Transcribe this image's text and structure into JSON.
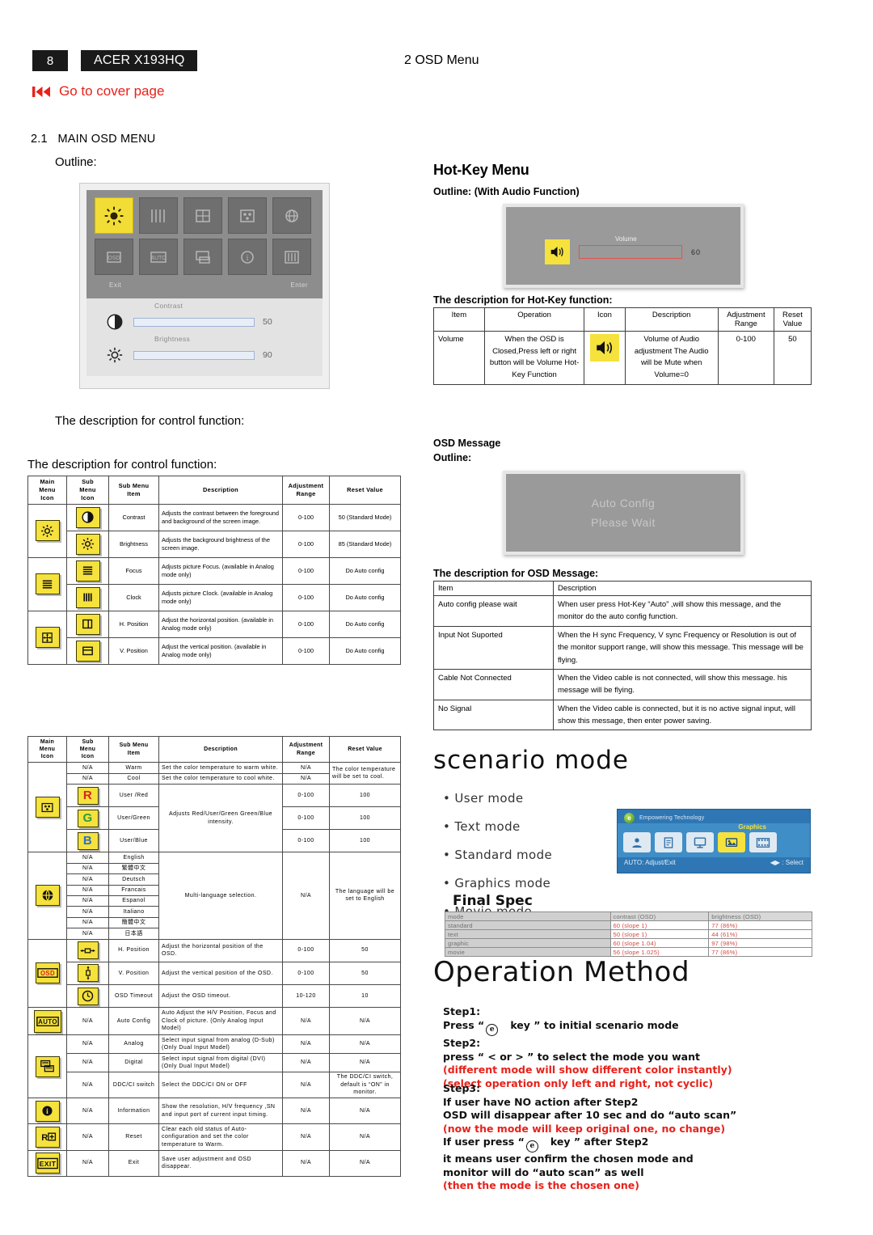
{
  "header": {
    "page_number": "8",
    "model": "ACER X193HQ",
    "chapter": "2 OSD Menu",
    "cover_link": "Go to cover page",
    "section_number": "2.1",
    "section_title": "MAIN OSD MENU",
    "outline_label": "Outline:",
    "accent_red": "#e8211a"
  },
  "osd_preview": {
    "footer_left": "Exit",
    "footer_right": "Enter",
    "sliders": [
      {
        "name": "Contrast",
        "value": "50",
        "percent": 50
      },
      {
        "name": "Brightness",
        "value": "90",
        "percent": 62
      }
    ],
    "tiles_row1": [
      "brightness-tile",
      "focus-tile",
      "position-tile",
      "color-tile",
      "language-tile"
    ],
    "tiles_row2": [
      "osd-tile",
      "auto-tile",
      "input-tile",
      "info-tile",
      "exit-tile"
    ]
  },
  "control_desc_1": "The description for control function:",
  "control_desc_2": "The description for control function:",
  "table_one": {
    "headers": [
      "Main Menu Icon",
      "Sub Menu Icon",
      "Sub Menu Item",
      "Description",
      "Adjustment Range",
      "Reset Value"
    ],
    "rows": [
      {
        "main_icon": "brightness-icon",
        "sub_icon": "contrast-icon",
        "item": "Contrast",
        "description": "Adjusts the contrast between the foreground and background of the screen image.",
        "range": "0-100",
        "reset": "50 (Standard Mode)"
      },
      {
        "main_icon": "",
        "sub_icon": "brightness-icon",
        "item": "Brightness",
        "description": "Adjusts the background brightness of the screen image.",
        "range": "0-100",
        "reset": "85 (Standard Mode)"
      },
      {
        "main_icon": "focus-icon",
        "sub_icon": "focus-icon",
        "item": "Focus",
        "description": "Adjusts picture Focus. (available in Analog mode only)",
        "range": "0-100",
        "reset": "Do Auto config"
      },
      {
        "main_icon": "",
        "sub_icon": "clock-icon",
        "item": "Clock",
        "description": "Adjusts picture Clock. (available in Analog mode only)",
        "range": "0-100",
        "reset": "Do Auto config"
      },
      {
        "main_icon": "position-icon",
        "sub_icon": "h-position-icon",
        "item": "H. Position",
        "description": "Adjust the horizontal position. (available in Analog mode only)",
        "range": "0-100",
        "reset": "Do Auto config"
      },
      {
        "main_icon": "",
        "sub_icon": "v-position-icon",
        "item": "V.  Position",
        "description": "Adjust the vertical position. (available in Analog mode only)",
        "range": "0-100",
        "reset": "Do Auto config"
      }
    ]
  },
  "table_two": {
    "headers": [
      "Main Menu Icon",
      "Sub Menu Icon",
      "Sub Menu Item",
      "Description",
      "Adjustment Range",
      "Reset Value"
    ],
    "color_group": {
      "main_icon": "color-icon",
      "warm": {
        "sub_icon": "N/A",
        "item": "Warm",
        "description": "Set the color temperature to warm white.",
        "range": "N/A"
      },
      "cool": {
        "sub_icon": "N/A",
        "item": "Cool",
        "description": "Set the color temperature to cool white.",
        "range": "N/A"
      },
      "temp_reset": "The color temperature will be set to cool.",
      "rgb_description": "Adjusts Red/User/Green Green/Blue intensity.",
      "rgb": [
        {
          "letter": "R",
          "item": "User /Red",
          "range": "0-100",
          "reset": "100"
        },
        {
          "letter": "G",
          "item": "User/Green",
          "range": "0-100",
          "reset": "100"
        },
        {
          "letter": "B",
          "item": "User/Blue",
          "range": "0-100",
          "reset": "100"
        }
      ]
    },
    "language_group": {
      "main_icon": "language-icon",
      "description": "Multi-language selection.",
      "range": "N/A",
      "reset": "The language will be set to English",
      "languages": [
        "English",
        "繁體中文",
        "Deutsch",
        "Francais",
        "Espanol",
        "Italiano",
        "簡體中文",
        "日本語"
      ],
      "sub_icon": "N/A"
    },
    "osd_group": {
      "main_icon": "osd-icon",
      "rows": [
        {
          "sub_icon": "h-position-osd-icon",
          "item": "H. Position",
          "description": "Adjust the horizontal position of the OSD.",
          "range": "0-100",
          "reset": "50"
        },
        {
          "sub_icon": "v-position-osd-icon",
          "item": "V.   Position",
          "description": "Adjust the vertical position of the OSD.",
          "range": "0-100",
          "reset": "50"
        },
        {
          "sub_icon": "timeout-icon",
          "item": "OSD Timeout",
          "description": "Adjust the OSD timeout.",
          "range": "10-120",
          "reset": "10"
        }
      ]
    },
    "auto_row": {
      "main_icon": "auto-icon",
      "sub_icon": "N/A",
      "item": "Auto Config",
      "description": "Auto Adjust the H/V Position, Focus and Clock of picture. (Only Analog Input Model)",
      "range": "N/A",
      "reset": "N/A"
    },
    "input_group": {
      "main_icon": "input-icon",
      "rows": [
        {
          "sub_icon": "N/A",
          "item": "Analog",
          "description": "Select input signal from analog (D-Sub) (Only Dual Input Model)",
          "range": "N/A",
          "reset": "N/A"
        },
        {
          "sub_icon": "N/A",
          "item": "Digital",
          "description": "Select input signal from digital (DVI) (Only Dual Input Model)",
          "range": "N/A",
          "reset": "N/A"
        },
        {
          "sub_icon": "N/A",
          "item": "DDC/CI switch",
          "description": "Select the DDC/CI ON or OFF",
          "range": "N/A",
          "reset": "The DDC/CI switch, default is “ON” in monitor."
        }
      ]
    },
    "info_row": {
      "main_icon": "information-icon",
      "sub_icon": "N/A",
      "item": "Information",
      "description": "Show the resolution, H/V frequency ,SN and input port of current input timing.",
      "range": "N/A",
      "reset": "N/A"
    },
    "reset_row": {
      "main_icon": "reset-icon",
      "sub_icon": "N/A",
      "item": "Reset",
      "description": "Clear each old status of Auto-configuration and set the color temperature to Warm.",
      "range": "N/A",
      "reset": "N/A"
    },
    "exit_row": {
      "main_icon": "exit-icon",
      "sub_icon": "N/A",
      "item": "Exit",
      "description": "Save user adjustment and OSD disappear.",
      "range": "N/A",
      "reset": "N/A"
    }
  },
  "hotkey": {
    "title": "Hot-Key Menu",
    "outline_label": "Outline: (With Audio Function)",
    "volume_mock": {
      "icon": "speaker-icon",
      "label": "Volume",
      "value": "60",
      "percent": 66
    },
    "desc_title": "The description for Hot-Key function:",
    "table": {
      "headers": [
        "Item",
        "Operation",
        "Icon",
        "Description",
        "Adjustment Range",
        "Reset Value"
      ],
      "rows": [
        {
          "item": "Volume",
          "operation": "When the OSD is Closed,Press left or right button will be Volume Hot-Key Function",
          "icon": "speaker-icon",
          "description": "Volume of Audio adjustment The Audio will be Mute when Volume=0",
          "range": "0-100",
          "reset": "50"
        }
      ]
    }
  },
  "osd_message": {
    "title": "OSD Message",
    "outline_label": "Outline:",
    "mock_line1": "Auto Config",
    "mock_line2": "Please Wait",
    "desc_title": "The description for OSD Message:",
    "table": {
      "headers": [
        "Item",
        "Description"
      ],
      "rows": [
        {
          "item": "Auto config please wait",
          "description": "When user press Hot-Key “Auto” ,will show this message, and the monitor do the auto config function."
        },
        {
          "item": "Input Not Suported",
          "description": "When the H sync Frequency, V sync Frequency or Resolution is out of the monitor support range, will show this message. This message will be flying."
        },
        {
          "item": "Cable Not Connected",
          "description": "When the Video cable is not connected, will show this message. his message will be flying."
        },
        {
          "item": "No Signal",
          "description": "When the Video cable is connected, but it is no active signal input, will show this message, then enter power saving."
        }
      ]
    }
  },
  "scenario": {
    "title": "scenario mode",
    "modes": [
      "User mode",
      "Text mode",
      "Standard mode",
      "Graphics mode",
      "Movie mode"
    ],
    "mock": {
      "brand": "Empowering Technology",
      "selected_label": "Graphics",
      "footer_left": "AUTO: Adjust/Exit",
      "footer_right": "◀▶ : Select",
      "icons": [
        "user-icon",
        "text-icon",
        "standard-icon",
        "graphics-icon",
        "movie-icon"
      ]
    },
    "final_spec": {
      "title": "Final Spec",
      "headers": [
        "mode",
        "contrast (OSD)",
        "brightness (OSD)"
      ],
      "rows": [
        {
          "mode": "standard",
          "contrast": "60 (slope 1)",
          "brightness": "77 (86%)"
        },
        {
          "mode": "text",
          "contrast": "50 (slope 1)",
          "brightness": "44 (61%)"
        },
        {
          "mode": "graphic",
          "contrast": "60 (slope 1.04)",
          "brightness": "97 (98%)"
        },
        {
          "mode": "movie",
          "contrast": "56 (slope 1.025)",
          "brightness": "77 (86%)"
        }
      ]
    }
  },
  "operation_method": {
    "title": "Operation Method",
    "step1_label": "Step1:",
    "step1_text_a": "Press “",
    "step1_text_b": "key ” to initial scenario mode",
    "step2_label": "Step2:",
    "step2_text": "press “ < or > ” to select the mode you want",
    "step2_red_1": "(different mode will show different color instantly)",
    "step2_red_2": "(select operation only left and right, not cyclic)",
    "step3_label": "Step3:",
    "step3_line1": "If user have NO action after Step2",
    "step3_line2": "OSD will disappear after 10 sec and do “auto scan”",
    "step3_red_1": "(now the mode will keep original one, no change)",
    "step3_line3_a": "If user press “",
    "step3_line3_b": "key ” after Step2",
    "step3_line4": "it means user confirm the chosen mode and",
    "step3_line5": "monitor will do “auto scan” as well",
    "step3_red_2": "(then the mode is the chosen one)",
    "key_glyph": "e"
  }
}
